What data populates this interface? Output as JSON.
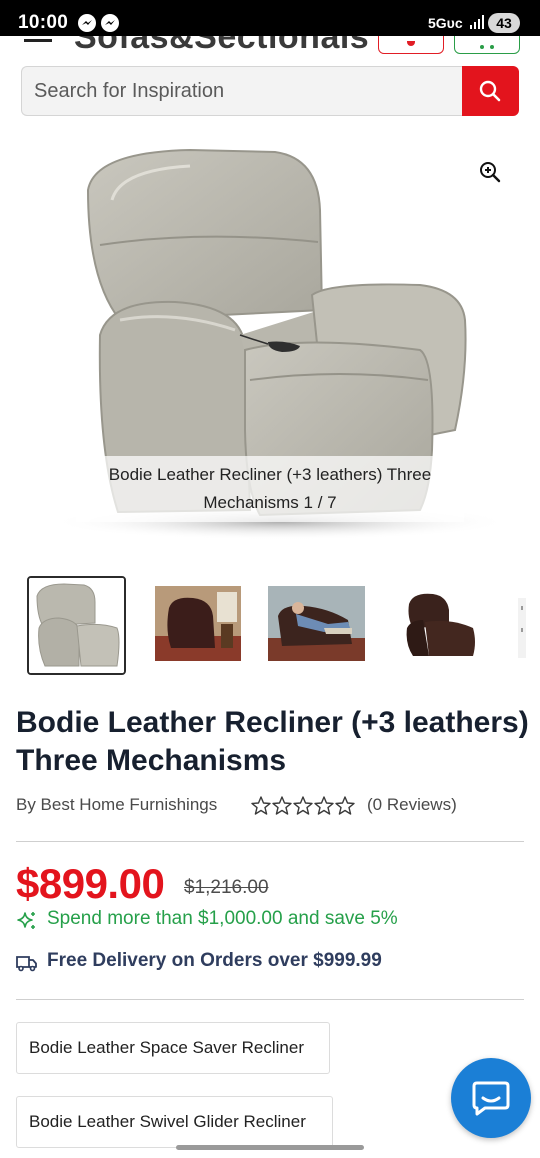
{
  "status_bar": {
    "time": "10:00",
    "network": "5Gᴜᴄ",
    "battery": "43"
  },
  "header": {
    "logo_text": "Sofas&Sectionals",
    "colors": {
      "wishlist": "#e11d25",
      "cart": "#2a9d47"
    }
  },
  "search": {
    "placeholder": "Search for Inspiration",
    "button_color": "#e3141d",
    "icon": "search-icon"
  },
  "gallery": {
    "caption": "Bodie Leather Recliner (+3 leathers) Three Mechanisms 1 / 7",
    "zoom_icon": "zoom-in-icon",
    "thumbnails": [
      {
        "alt": "Gray leather power recliner",
        "active": true
      },
      {
        "alt": "Dark brown recliner in living room",
        "active": false
      },
      {
        "alt": "Man reclining in brown leather recliner",
        "active": false
      },
      {
        "alt": "Brown leather recliner",
        "active": false
      },
      {
        "alt": "Partial thumbnail",
        "active": false
      }
    ]
  },
  "product": {
    "title": "Bodie Leather Recliner (+3 leathers) Three Mechanisms",
    "brand": "By Best Home Furnishings",
    "rating": 0,
    "rating_max": 5,
    "reviews": "(0 Reviews)",
    "price": "$899.00",
    "old_price": "$1,216.00",
    "promo": "Spend more than $1,000.00 and save 5%",
    "delivery": "Free Delivery on Orders over $999.99",
    "price_color": "#e3141d",
    "promo_color": "#26a04a"
  },
  "variants": [
    {
      "label": "Bodie Leather Space Saver Recliner"
    },
    {
      "label": "Bodie Leather Swivel Glider Recliner"
    }
  ],
  "chat": {
    "icon": "chat-bubble-icon",
    "color": "#1b7fd6"
  }
}
